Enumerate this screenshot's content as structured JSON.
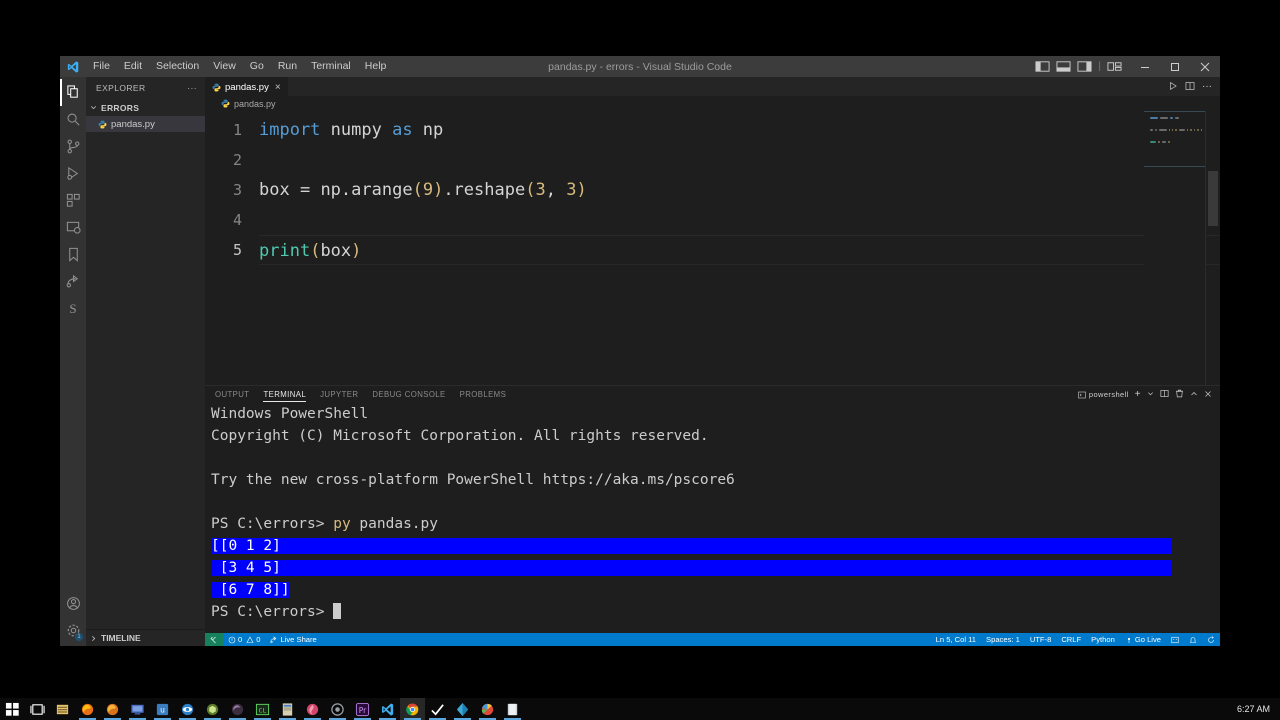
{
  "window": {
    "title": "pandas.py - errors - Visual Studio Code",
    "menu": [
      "File",
      "Edit",
      "Selection",
      "View",
      "Go",
      "Run",
      "Terminal",
      "Help"
    ],
    "layout_icons": [
      "panel-left-icon",
      "panel-bottom-icon",
      "panel-right-icon",
      "customize-layout-icon"
    ],
    "controls": {
      "minimize": "minimize-icon",
      "maximize": "maximize-icon",
      "close": "close-icon"
    }
  },
  "activitybar": {
    "items": [
      {
        "name": "explorer",
        "icon": "files-icon",
        "active": true
      },
      {
        "name": "search",
        "icon": "search-icon",
        "active": false
      },
      {
        "name": "source-control",
        "icon": "source-control-icon",
        "active": false
      },
      {
        "name": "run-and-debug",
        "icon": "run-debug-icon",
        "active": false
      },
      {
        "name": "extensions",
        "icon": "extensions-icon",
        "active": false
      },
      {
        "name": "remote-explorer",
        "icon": "remote-explorer-icon",
        "active": false
      },
      {
        "name": "bookmarks",
        "icon": "bookmark-icon",
        "active": false
      },
      {
        "name": "live-share",
        "icon": "live-share-icon",
        "active": false
      },
      {
        "name": "sourcery",
        "icon": "sourcery-s-icon",
        "active": false
      }
    ],
    "bottom": [
      {
        "name": "accounts",
        "icon": "account-icon",
        "badge": ""
      },
      {
        "name": "manage-settings",
        "icon": "gear-icon",
        "badge": "1"
      }
    ]
  },
  "sidebar": {
    "title": "EXPLORER",
    "more_actions": "···",
    "folder": "ERRORS",
    "files": [
      {
        "name": "pandas.py",
        "selected": true
      }
    ],
    "timeline": "TIMELINE"
  },
  "editor": {
    "tabs": [
      {
        "label": "pandas.py",
        "active": true,
        "close": "×"
      }
    ],
    "actions": [
      "run-python-file-icon",
      "split-editor-icon",
      "more-actions-icon"
    ],
    "breadcrumb": "pandas.py",
    "lines": [
      {
        "n": "1",
        "current": false,
        "tokens": [
          {
            "t": "import",
            "c": "kw"
          },
          {
            "t": " numpy ",
            "c": "plain"
          },
          {
            "t": "as",
            "c": "kw"
          },
          {
            "t": " np",
            "c": "plain"
          }
        ]
      },
      {
        "n": "2",
        "current": false,
        "tokens": []
      },
      {
        "n": "3",
        "current": false,
        "tokens": [
          {
            "t": "box ",
            "c": "plain"
          },
          {
            "t": "=",
            "c": "plain"
          },
          {
            "t": " np.arange",
            "c": "plain"
          },
          {
            "t": "(",
            "c": "yel"
          },
          {
            "t": "9",
            "c": "yel"
          },
          {
            "t": ")",
            "c": "yel"
          },
          {
            "t": ".reshape",
            "c": "plain"
          },
          {
            "t": "(",
            "c": "yel"
          },
          {
            "t": "3",
            "c": "yel"
          },
          {
            "t": ", ",
            "c": "plain"
          },
          {
            "t": "3",
            "c": "yel"
          },
          {
            "t": ")",
            "c": "yel"
          }
        ]
      },
      {
        "n": "4",
        "current": false,
        "tokens": []
      },
      {
        "n": "5",
        "current": true,
        "tokens": [
          {
            "t": "print",
            "c": "grn"
          },
          {
            "t": "(",
            "c": "yel"
          },
          {
            "t": "box",
            "c": "plain"
          },
          {
            "t": ")",
            "c": "yel"
          }
        ]
      }
    ]
  },
  "panel": {
    "tabs": [
      {
        "label": "OUTPUT",
        "active": false
      },
      {
        "label": "TERMINAL",
        "active": true
      },
      {
        "label": "JUPYTER",
        "active": false
      },
      {
        "label": "DEBUG CONSOLE",
        "active": false
      },
      {
        "label": "PROBLEMS",
        "active": false
      }
    ],
    "shell": "powershell",
    "actions": [
      "new-terminal-icon",
      "chevron-down-icon",
      "split-terminal-icon",
      "kill-terminal-icon",
      "maximize-panel-icon",
      "close-panel-icon"
    ],
    "terminal_lines": [
      {
        "text": "Windows PowerShell",
        "selected": false
      },
      {
        "text": "Copyright (C) Microsoft Corporation. All rights reserved.",
        "selected": false
      },
      {
        "text": "",
        "selected": false
      },
      {
        "text": "Try the new cross-platform PowerShell https://aka.ms/pscore6",
        "selected": false
      },
      {
        "text": "",
        "selected": false
      },
      {
        "text": "PS C:\\errors> py pandas.py",
        "selected": false,
        "prompt": true,
        "cmd": "py",
        "arg": " pandas.py"
      },
      {
        "text": "[[0 1 2]",
        "selected": true,
        "full": true
      },
      {
        "text": " [3 4 5]",
        "selected": true,
        "full": true
      },
      {
        "text": " [6 7 8]]",
        "selected": true,
        "full": false
      },
      {
        "text": "PS C:\\errors> ",
        "selected": false,
        "cursor": true
      }
    ]
  },
  "statusbar": {
    "remote_icon": "remote-window-icon",
    "problems": {
      "errors_icon": "error-icon",
      "errors": "0",
      "warnings_icon": "warning-icon",
      "warnings": "0"
    },
    "live_share": "Live Share",
    "right": [
      {
        "label": "Ln 5, Col 11",
        "name": "cursor-position"
      },
      {
        "label": "Spaces: 1",
        "name": "indentation"
      },
      {
        "label": "UTF-8",
        "name": "encoding"
      },
      {
        "label": "CRLF",
        "name": "eol"
      },
      {
        "label": "Python",
        "name": "language-mode"
      },
      {
        "label": "Go Live",
        "name": "go-live",
        "icon": "broadcast-icon"
      }
    ],
    "right_icons": [
      "smiley-feedback-icon",
      "bell-icon",
      "sync-icon"
    ],
    "colors": {
      "accent": "#007acc",
      "remote": "#16825d"
    }
  },
  "taskbar": {
    "left_icons": [
      "start-icon",
      "task-view-icon",
      "file-explorer-icon",
      "firefox-icon",
      "firefox-dev-icon",
      "remote-desktop-icon",
      "media-icon",
      "eye-icon",
      "unity-icon",
      "edge-dev-icon",
      "cl-terminal-icon",
      "notes-icon",
      "brand-icon"
    ],
    "right_icons": [
      "chrome-canary-icon",
      "premiere-icon",
      "vscode-icon",
      "chrome-icon",
      "check-icon",
      "diamond-icon",
      "photos-icon",
      "folder-icon"
    ],
    "clock": "6:27 AM"
  }
}
